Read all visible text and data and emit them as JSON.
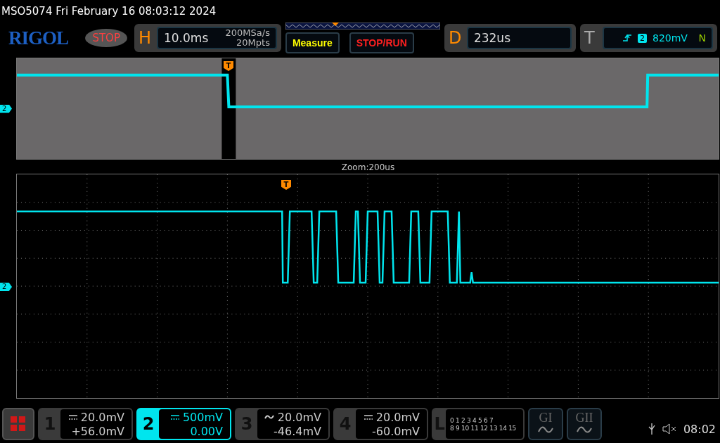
{
  "status_line": "MSO5074  Fri February 16 08:03:12 2024",
  "logo": "RIGOL",
  "run_state": {
    "label": "STOP",
    "kind": "stopped"
  },
  "horizontal": {
    "label": "H",
    "timebase": "10.0ms",
    "sample_rate": "200MSa/s",
    "memory_depth": "20Mpts"
  },
  "measure_button": "Measure",
  "stop_run_button": "STOP/RUN",
  "delay": {
    "label": "D",
    "value": "232us"
  },
  "trigger": {
    "label": "T",
    "channel": "2",
    "level": "820mV",
    "mode": "N"
  },
  "overview": {
    "channel_marker": "2",
    "trigger_marker": "T"
  },
  "zoom_label": "Zoom:200us",
  "main": {
    "channel_marker": "2",
    "trigger_marker": "T"
  },
  "channels": [
    {
      "number": "1",
      "kind": "dc",
      "scale": "20.0mV",
      "offset": "+56.0mV",
      "selected": false
    },
    {
      "number": "2",
      "kind": "dc",
      "scale": "500mV",
      "offset": "0.00V",
      "selected": true
    },
    {
      "number": "3",
      "kind": "ac",
      "scale": "20.0mV",
      "offset": "-46.4mV",
      "selected": false
    },
    {
      "number": "4",
      "kind": "dc",
      "scale": "20.0mV",
      "offset": "-60.0mV",
      "selected": false
    }
  ],
  "logic": {
    "label": "L",
    "row_1": "0 1 2 3  4 5 6 7",
    "row_2": "8 9 10 11 12 13 14 15"
  },
  "generators": [
    {
      "label": "GI"
    },
    {
      "label": "GII"
    }
  ],
  "clock": "08:02"
}
